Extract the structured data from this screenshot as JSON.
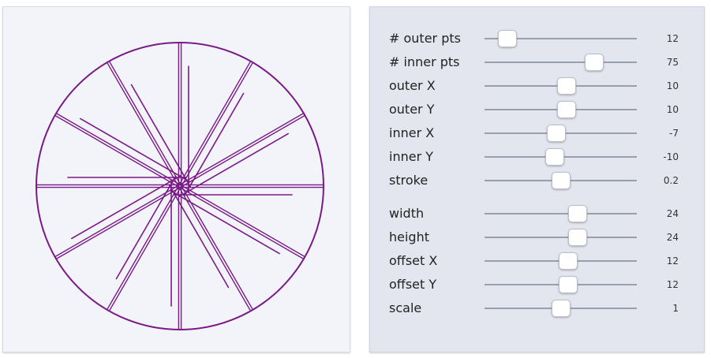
{
  "colors": {
    "stroke": "#7a1a86",
    "preview_bg": "#f2f4fa",
    "panel_bg": "#e3e6ee"
  },
  "sliders": [
    {
      "id": "outer-pts",
      "label": "# outer pts",
      "value": "12",
      "position": 0.15
    },
    {
      "id": "inner-pts",
      "label": "# inner pts",
      "value": "75",
      "position": 0.72
    },
    {
      "id": "outer-x",
      "label": "outer X",
      "value": "10",
      "position": 0.54
    },
    {
      "id": "outer-y",
      "label": "outer Y",
      "value": "10",
      "position": 0.54
    },
    {
      "id": "inner-x",
      "label": "inner X",
      "value": "-7",
      "position": 0.47
    },
    {
      "id": "inner-y",
      "label": "inner Y",
      "value": "-10",
      "position": 0.46
    },
    {
      "id": "stroke",
      "label": "stroke",
      "value": "0.2",
      "position": 0.5
    },
    {
      "id": "width",
      "label": "width",
      "value": "24",
      "position": 0.61
    },
    {
      "id": "height",
      "label": "height",
      "value": "24",
      "position": 0.61
    },
    {
      "id": "offset-x",
      "label": "offset X",
      "value": "12",
      "position": 0.55
    },
    {
      "id": "offset-y",
      "label": "offset Y",
      "value": "12",
      "position": 0.55
    },
    {
      "id": "scale",
      "label": "scale",
      "value": "1",
      "position": 0.5
    }
  ]
}
